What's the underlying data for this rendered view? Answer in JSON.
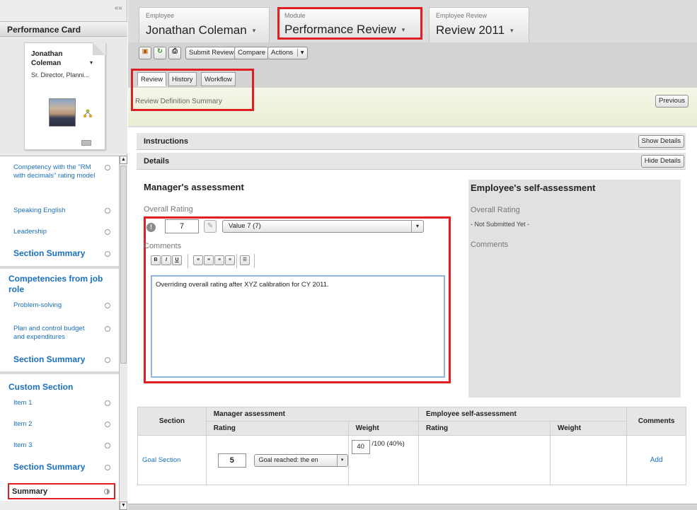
{
  "sidebar": {
    "collapse_label": "««",
    "performance_card_title": "Performance Card",
    "card": {
      "name_line1": "Jonathan",
      "name_line2": "Coleman",
      "role": "Sr. Director, Planni..."
    },
    "items": [
      {
        "label": "Competency with the \"RM with decimals\" rating model",
        "bold": false
      },
      {
        "label": "Speaking English",
        "bold": false
      },
      {
        "label": "Leadership",
        "bold": false
      },
      {
        "label": "Section Summary",
        "bold": true
      },
      {
        "section_title": "Competencies from job role"
      },
      {
        "label": "Problem-solving",
        "bold": false
      },
      {
        "label": "Plan and control budget and expenditures",
        "bold": false
      },
      {
        "label": "Section Summary",
        "bold": true
      },
      {
        "section_title": "Custom Section"
      },
      {
        "label": "Item 1",
        "bold": false
      },
      {
        "label": "Item 2",
        "bold": false
      },
      {
        "label": "Item 3",
        "bold": false
      },
      {
        "label": "Section Summary",
        "bold": true
      }
    ],
    "summary_label": "Summary"
  },
  "header": {
    "employee": {
      "caption": "Employee",
      "value": "Jonathan Coleman"
    },
    "module": {
      "caption": "Module",
      "value": "Performance Review"
    },
    "review": {
      "caption": "Employee Review",
      "value": "Review 2011"
    },
    "dropdown_glyph": "▾"
  },
  "toolbar": {
    "save_icon": "▣",
    "refresh_icon": "↻",
    "print_icon": "⎙",
    "submit_review": "Submit Review",
    "compare": "Compare",
    "actions": "Actions",
    "actions_chevron": "▾"
  },
  "tabs": [
    {
      "label": "Review",
      "active": true
    },
    {
      "label": "History",
      "active": false
    },
    {
      "label": "Workflow",
      "active": false
    }
  ],
  "definition_summary": "Review Definition Summary",
  "previous_button": "Previous",
  "instructions": {
    "title": "Instructions",
    "button": "Show Details"
  },
  "details": {
    "title": "Details",
    "button": "Hide Details"
  },
  "manager": {
    "title": "Manager's assessment",
    "overall_label": "Overall Rating",
    "warning_glyph": "!",
    "rating_value": "7",
    "calibration_glyph": "✎",
    "rating_select": "Value 7 (7)",
    "select_chevron": "▾",
    "comments_label": "Comments",
    "format_buttons": [
      "B",
      "I",
      "U"
    ],
    "align_buttons": [
      "≡",
      "≡",
      "≡",
      "≡"
    ],
    "list_button": "☰",
    "comment_text": "Overriding overall rating after XYZ calibration for CY 2011."
  },
  "employee_self": {
    "title": "Employee's self-assessment",
    "overall_label": "Overall Rating",
    "status": "- Not Submitted Yet -",
    "comments_label": "Comments"
  },
  "table": {
    "headers": {
      "section": "Section",
      "manager_group": "Manager assessment",
      "employee_group": "Employee self-assessment",
      "comments": "Comments",
      "rating": "Rating",
      "weight": "Weight"
    },
    "rows": [
      {
        "section": "Goal Section",
        "manager_rating": "5",
        "manager_rating_select": "Goal reached: the en",
        "weight_value": "40",
        "weight_suffix": "/100 (40%)",
        "comment_action": "Add"
      }
    ]
  },
  "colors": {
    "highlight": "#e01f25",
    "link": "#1a6fbe"
  }
}
